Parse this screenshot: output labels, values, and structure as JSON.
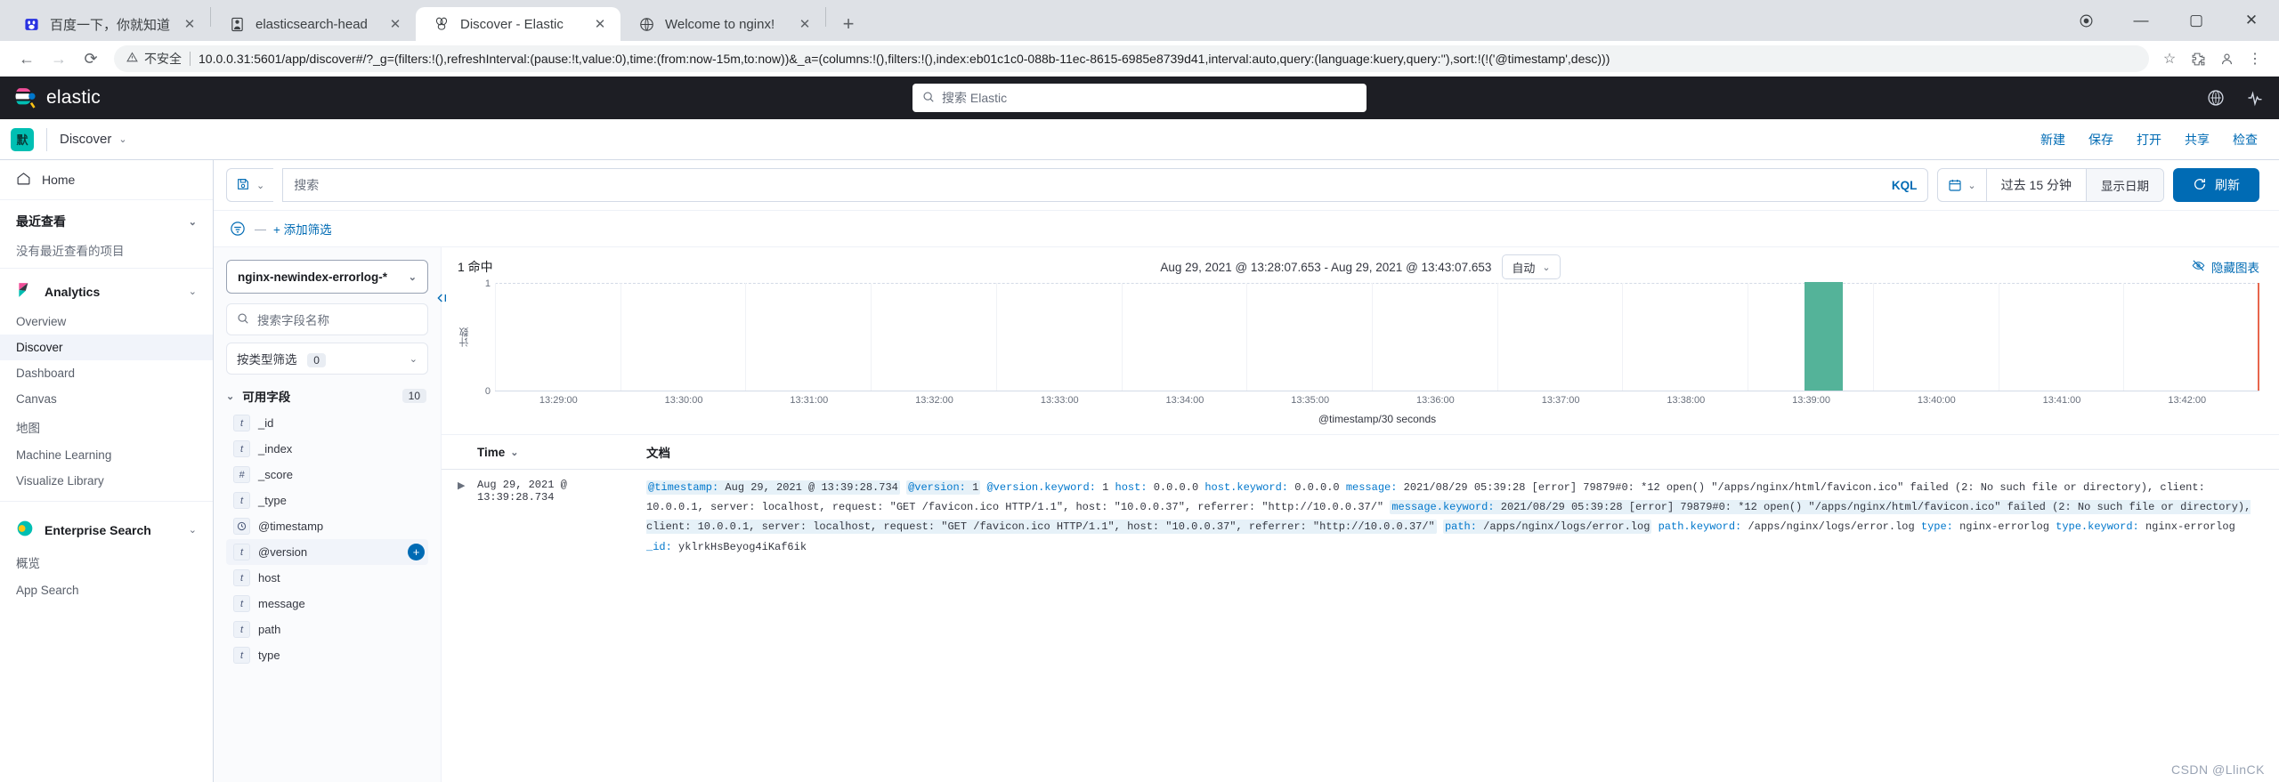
{
  "browser": {
    "tabs": [
      {
        "title": "百度一下，你就知道",
        "icon": "baidu-icon",
        "active": false
      },
      {
        "title": "elasticsearch-head",
        "icon": "elasticsearch-head-icon",
        "active": false
      },
      {
        "title": "Discover - Elastic",
        "icon": "elastic-icon",
        "active": true
      },
      {
        "title": "Welcome to nginx!",
        "icon": "globe-icon",
        "active": false
      }
    ],
    "new_tab_label": "+",
    "window_controls": {
      "minimize": "—",
      "maximize": "▢",
      "close": "✕"
    },
    "nav": {
      "back": "←",
      "forward": "→",
      "reload": "⟳"
    },
    "omnibox": {
      "insecure_label": "不安全",
      "warning_icon": "warning-triangle-icon",
      "url": "10.0.0.31:5601/app/discover#/?_g=(filters:!(),refreshInterval:(pause:!t,value:0),time:(from:now-15m,to:now))&_a=(columns:!(),filters:!(),index:eb01c1c0-088b-11ec-8615-6985e8739d41,interval:auto,query:(language:kuery,query:''),sort:!(!('@timestamp',desc)))",
      "bookmark_icon": "star-icon",
      "extensions_icon": "puzzle-icon",
      "profile_icon": "person-icon",
      "menu_icon": "kebab-menu-icon"
    }
  },
  "kibana_header": {
    "logo_text": "elastic",
    "search_placeholder": "搜索 Elastic",
    "search_icon": "search-icon",
    "right_icons": [
      "help-icon",
      "deployment-icon"
    ]
  },
  "kibana_navbar": {
    "space_badge": "默",
    "breadcrumb": "Discover",
    "breadcrumb_chevron": "chevron-down-icon",
    "actions": [
      "新建",
      "保存",
      "打开",
      "共享",
      "检查"
    ]
  },
  "sidebar": {
    "home": {
      "label": "Home",
      "icon": "home-icon"
    },
    "recently_viewed": {
      "title": "最近查看",
      "empty": "没有最近查看的项目",
      "chevron": "chevron-down-icon"
    },
    "groups": [
      {
        "title": "Analytics",
        "icon": "kibana-logo-icon",
        "chevron": "chevron-down-icon",
        "items": [
          {
            "label": "Overview",
            "selected": false
          },
          {
            "label": "Discover",
            "selected": true
          },
          {
            "label": "Dashboard",
            "selected": false
          },
          {
            "label": "Canvas",
            "selected": false
          },
          {
            "label": "地图",
            "selected": false
          },
          {
            "label": "Machine Learning",
            "selected": false
          },
          {
            "label": "Visualize Library",
            "selected": false
          }
        ]
      },
      {
        "title": "Enterprise Search",
        "icon": "enterprise-search-logo-icon",
        "chevron": "chevron-down-icon",
        "items": [
          {
            "label": "概览",
            "selected": false
          },
          {
            "label": "App Search",
            "selected": false
          }
        ]
      }
    ]
  },
  "query_bar": {
    "saved_query_icon": "save-disk-icon",
    "saved_query_chevron": "chevron-down-icon",
    "search_placeholder": "搜索",
    "kql_label": "KQL",
    "calendar_icon": "calendar-icon",
    "calendar_chevron": "chevron-down-icon",
    "time_range": "过去 15 分钟",
    "show_dates_label": "显示日期",
    "refresh_label": "刷新",
    "refresh_icon": "refresh-icon"
  },
  "filter_bar": {
    "filter_icon": "filter-settings-icon",
    "dash": "—",
    "add_filter_label": "+ 添加筛选"
  },
  "field_panel": {
    "index_pattern": "nginx-newindex-errorlog-*",
    "index_chevron": "chevron-down-icon",
    "search_placeholder": "搜索字段名称",
    "search_icon": "search-icon",
    "type_filter_label": "按类型筛选",
    "type_filter_count": "0",
    "type_filter_chevron": "chevron-down-icon",
    "available_fields_label": "可用字段",
    "available_fields_count": "10",
    "available_fields_chevron": "chevron-down-icon",
    "collapse_icon": "collapse-panel-icon",
    "fields": [
      {
        "name": "_id",
        "type": "t",
        "hover": false
      },
      {
        "name": "_index",
        "type": "t",
        "hover": false
      },
      {
        "name": "_score",
        "type": "#",
        "hover": false
      },
      {
        "name": "_type",
        "type": "t",
        "hover": false
      },
      {
        "name": "@timestamp",
        "type": "clock",
        "hover": false
      },
      {
        "name": "@version",
        "type": "t",
        "hover": true
      },
      {
        "name": "host",
        "type": "t",
        "hover": false
      },
      {
        "name": "message",
        "type": "t",
        "hover": false
      },
      {
        "name": "path",
        "type": "t",
        "hover": false
      },
      {
        "name": "type",
        "type": "t",
        "hover": false
      }
    ],
    "add_field_button": "+"
  },
  "histogram": {
    "hits_label": "1 命中",
    "time_range_label": "Aug 29, 2021 @ 13:28:07.653 - Aug 29, 2021 @ 13:43:07.653",
    "interval_value": "自动",
    "interval_chevron": "chevron-down-icon",
    "hide_chart_label": "隐藏图表",
    "hide_chart_icon": "eye-slash-icon"
  },
  "chart_data": {
    "type": "bar",
    "title": "",
    "xlabel": "@timestamp/30 seconds",
    "ylabel": "计数",
    "categories": [
      "13:29:00",
      "13:30:00",
      "13:31:00",
      "13:32:00",
      "13:33:00",
      "13:34:00",
      "13:35:00",
      "13:36:00",
      "13:37:00",
      "13:38:00",
      "13:39:00",
      "13:40:00",
      "13:41:00",
      "13:42:00"
    ],
    "tick_labels": [
      "13:29:00",
      "13:30:00",
      "13:31:00",
      "13:32:00",
      "13:33:00",
      "13:34:00",
      "13:35:00",
      "13:36:00",
      "13:37:00",
      "13:38:00",
      "13:39:00",
      "13:40:00",
      "13:41:00",
      "13:42:00"
    ],
    "values": [
      0,
      0,
      0,
      0,
      0,
      0,
      0,
      0,
      0,
      0,
      1,
      0,
      0,
      0
    ],
    "bar_color": "#54b399",
    "bar_center_ratio": 0.765,
    "ylim": [
      0,
      1
    ],
    "y_ticks": [
      "0",
      "1"
    ],
    "grid": true,
    "legend": "none",
    "annotations": [
      {
        "type": "right-edge-marker",
        "color": "#e7664c",
        "position_ratio": 0.998
      }
    ]
  },
  "doc_table": {
    "columns": [
      "Time",
      "文档"
    ],
    "time_sort_icon": "sort-desc-icon",
    "expand_icon": "expand-row-icon",
    "rows": [
      {
        "time": "Aug 29, 2021 @ 13:39:28.734",
        "fields": [
          {
            "key": "@timestamp:",
            "value": "Aug 29, 2021 @ 13:39:28.734",
            "highlight": true
          },
          {
            "key": "@version:",
            "value": "1",
            "highlight": true
          },
          {
            "key": "@version.keyword:",
            "value": "1",
            "highlight": false
          },
          {
            "key": "host:",
            "value": "0.0.0.0",
            "highlight": false
          },
          {
            "key": "host.keyword:",
            "value": "0.0.0.0",
            "highlight": false
          },
          {
            "key": "message:",
            "value": "2021/08/29 05:39:28 [error] 79879#0: *12 open() \"/apps/nginx/html/favicon.ico\" failed (2: No such file or directory), client: 10.0.0.1, server: localhost, request: \"GET /favicon.ico HTTP/1.1\", host: \"10.0.0.37\", referrer: \"http://10.0.0.37/\"",
            "highlight": false
          },
          {
            "key": "message.keyword:",
            "value": "2021/08/29 05:39:28 [error] 79879#0: *12 open() \"/apps/nginx/html/favicon.ico\" failed (2: No such file or directory), client: 10.0.0.1, server: localhost, request: \"GET /favicon.ico HTTP/1.1\", host: \"10.0.0.37\", referrer: \"http://10.0.0.37/\"",
            "highlight": true
          },
          {
            "key": "path:",
            "value": "/apps/nginx/logs/error.log",
            "highlight": true
          },
          {
            "key": "path.keyword:",
            "value": "/apps/nginx/logs/error.log",
            "highlight": false
          },
          {
            "key": "type:",
            "value": "nginx-errorlog",
            "highlight": false
          },
          {
            "key": "type.keyword:",
            "value": "nginx-errorlog",
            "highlight": false
          },
          {
            "key": "_id:",
            "value": "yklrkHsBeyog4iKaf6ik",
            "highlight": false
          }
        ]
      }
    ]
  },
  "watermark": "CSDN @LlinCK"
}
